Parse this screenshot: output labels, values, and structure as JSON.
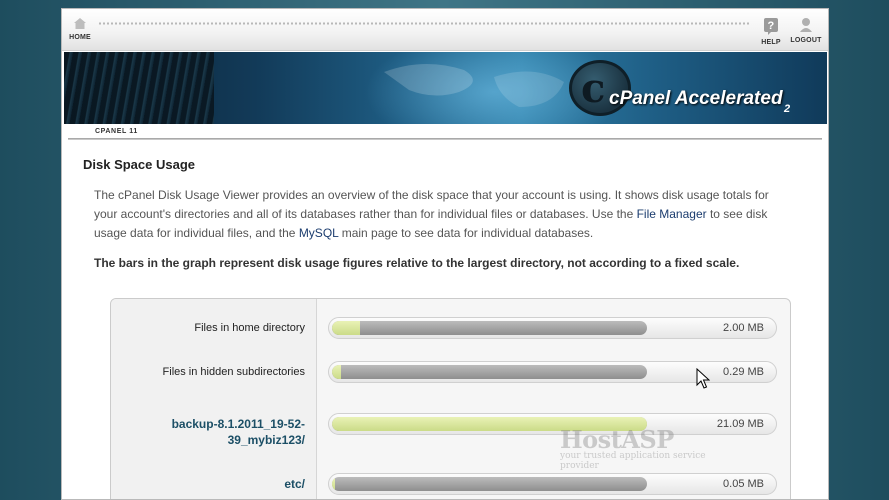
{
  "nav": {
    "home_label": "HOME",
    "help_label": "HELP",
    "logout_label": "LOGOUT"
  },
  "banner": {
    "brand": "cPanel Accelerated",
    "brand_sub": "2"
  },
  "breadcrumb": "CPANEL 11",
  "page": {
    "title": "Disk Space Usage",
    "intro_part1": "The cPanel Disk Usage Viewer provides an overview of the disk space that your account is using. It shows disk usage totals for your account's directories and all of its databases rather than for individual files or databases. Use the ",
    "file_manager_link": "File Manager",
    "intro_part2": " to see disk usage data for individual files, and the ",
    "mysql_link": "MySQL",
    "intro_part3": " main page to see data for individual databases.",
    "note": "The bars in the graph represent disk usage figures relative to the largest directory, not according to a fixed scale."
  },
  "usage_rows": [
    {
      "label": "Files in home directory",
      "size": "2.00 MB",
      "fill_fraction": 0.09,
      "is_link": false
    },
    {
      "label": "Files in hidden subdirectories",
      "size": "0.29 MB",
      "fill_fraction": 0.03,
      "is_link": false
    },
    {
      "label": "backup-8.1.2011_19-52-39_mybiz123/",
      "size": "21.09 MB",
      "fill_fraction": 1.0,
      "is_link": true
    },
    {
      "label": "etc/",
      "size": "0.05 MB",
      "fill_fraction": 0.01,
      "is_link": true
    }
  ],
  "watermark": {
    "name": "HostASP",
    "tagline": "your trusted application service provider"
  },
  "colors": {
    "bar_fill": "#cbdb88",
    "bar_track": "#9a9a9a",
    "link": "#1c4f66"
  }
}
